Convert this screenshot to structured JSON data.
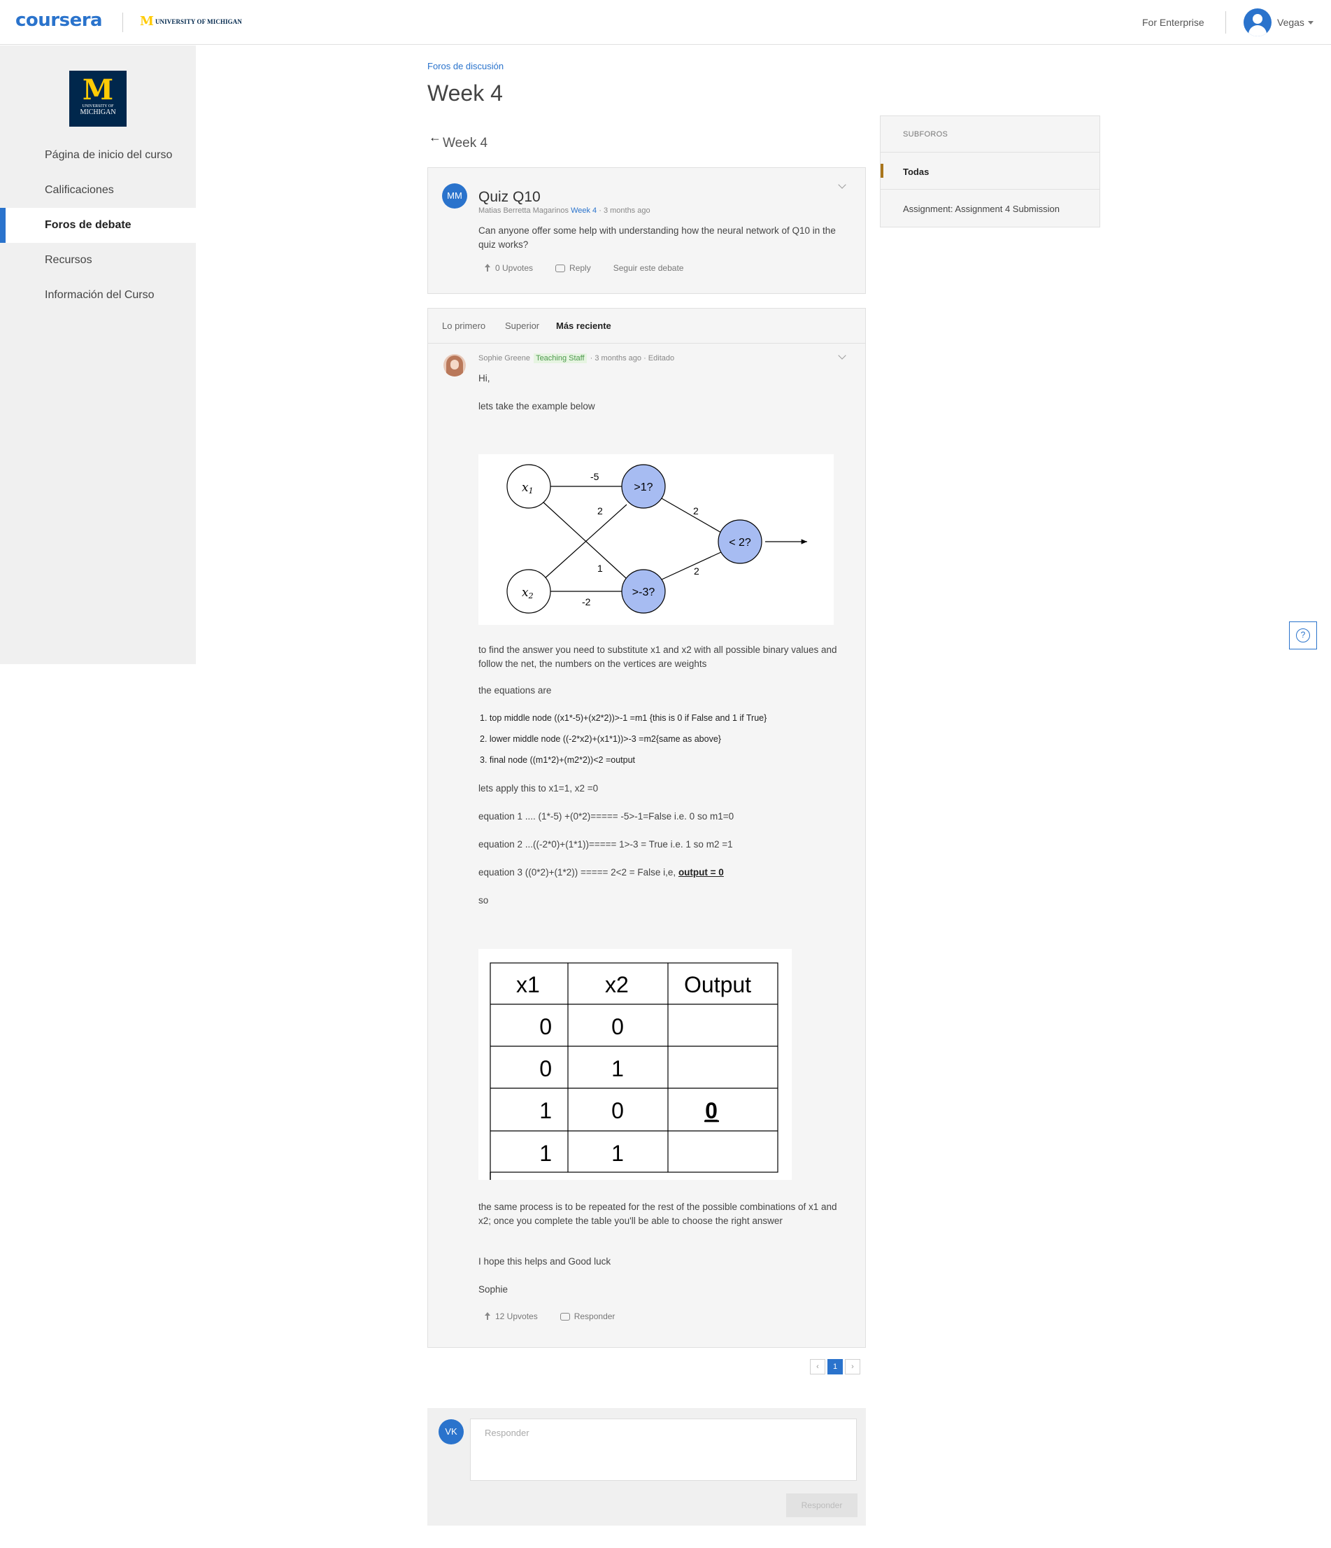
{
  "header": {
    "logo": "coursera",
    "university_logo_text": "UNIVERSITY OF MICHIGAN",
    "university_logo_letter": "M",
    "enterprise_link": "For Enterprise",
    "user_name": "Vegas",
    "icons": [
      "user-avatar-icon",
      "chevron-down-icon"
    ]
  },
  "sidebar": {
    "logo": {
      "letter": "M",
      "line1": "UNIVERSITY OF",
      "line2": "MICHIGAN"
    },
    "items": [
      {
        "label": "Página de inicio del curso",
        "active": false
      },
      {
        "label": "Calificaciones",
        "active": false
      },
      {
        "label": "Foros de debate",
        "active": true
      },
      {
        "label": "Recursos",
        "active": false
      },
      {
        "label": "Información del Curso",
        "active": false
      }
    ],
    "accent_color": "#2a73cc"
  },
  "main": {
    "breadcrumb": "Foros de discusión",
    "title": "Week 4",
    "back_label": "Week 4",
    "question": {
      "avatar_initials": "MM",
      "title": "Quiz Q10",
      "author": "Matias Berretta Magarinos",
      "forum": "Week 4",
      "time": "· 3 months ago",
      "body": "Can anyone offer some help with understanding how the neural network of Q10 in the quiz works?",
      "upvotes": "0 Upvotes",
      "reply": "Reply",
      "follow": "Seguir este debate"
    },
    "sort": {
      "options": [
        "Lo primero",
        "Superior",
        "Más reciente"
      ],
      "selected": "Más reciente"
    },
    "answer": {
      "author": "Sophie Greene",
      "badge": "Teaching Staff",
      "time": "· 3 months ago · Editado",
      "greeting": "Hi,",
      "intro": "lets take the example below",
      "network": {
        "nodes": {
          "x1": "x",
          "x1_sub": "1",
          "x2": "x",
          "x2_sub": "2",
          "top": ">1?",
          "bottom": ">-3?",
          "final": "< 2?"
        },
        "weights": {
          "x1_top": "-5",
          "x2_top": "2",
          "x1_bottom": "1",
          "x2_bottom": "-2",
          "top_final": "2",
          "bottom_final": "2"
        },
        "node_color": "#a7bcf2"
      },
      "p_substitute": "to find the answer you need to substitute x1 and x2 with all possible binary values and follow the net, the numbers on the vertices are weights",
      "p_equations": "the equations are",
      "equations": [
        "1.  top middle node ((x1*-5)+(x2*2))>-1 =m1 {this is 0 if False and 1 if True}",
        "2.  lower middle node ((-2*x2)+(x1*1))>-3 =m2{same as above}",
        "3.  final node ((m1*2)+(m2*2))<2 =output"
      ],
      "p_apply": "lets apply this to x1=1, x2 =0",
      "eq1": "equation 1 .... (1*-5) +(0*2)===== -5>-1=False i.e. 0 so m1=0",
      "eq2": "equation 2 ...((-2*0)+(1*1))===== 1>-3 = True i.e. 1 so m2 =1",
      "eq3": "equation 3 ((0*2)+(1*2)) ===== 2<2 = False i,e, ",
      "eq3_bold": "output = 0",
      "p_so": "so",
      "table": {
        "headers": [
          "x1",
          "x2",
          "Output"
        ],
        "rows": [
          [
            "0",
            "0",
            ""
          ],
          [
            "0",
            "1",
            ""
          ],
          [
            "1",
            "0",
            "0"
          ],
          [
            "1",
            "1",
            ""
          ]
        ]
      },
      "p_same": "the same process is to be repeated for the rest of the possible combinations of x1 and x2; once you complete the table you'll be able to choose the right answer",
      "p_hope": "I hope this helps and Good luck",
      "signature": "Sophie",
      "upvotes": "12 Upvotes",
      "reply": "Responder"
    },
    "pagination": {
      "prev": "‹",
      "current": "1",
      "next": "›"
    },
    "reply_box": {
      "avatar_initials": "VK",
      "placeholder": "Responder",
      "value": "",
      "button": "Responder"
    }
  },
  "subforums": {
    "heading": "SUBFOROS",
    "items": [
      {
        "label": "Todas",
        "active": true
      },
      {
        "label": "Assignment: Assignment 4 Submission",
        "active": false
      }
    ],
    "accent_color": "#a9751c"
  },
  "help": {
    "label": "?"
  }
}
